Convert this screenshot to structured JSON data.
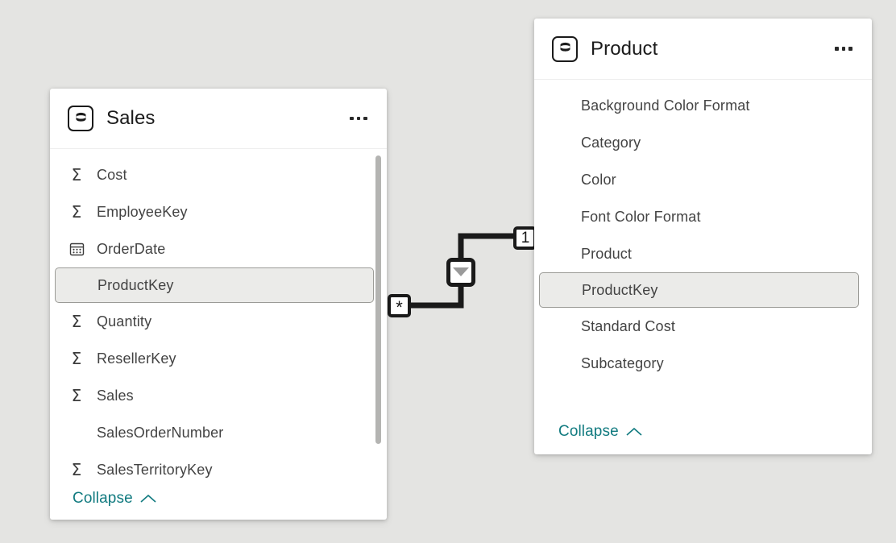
{
  "canvas": {
    "background_color": "#e4e4e2"
  },
  "tables": [
    {
      "id": "sales",
      "title": "Sales",
      "icon": "table-database-icon",
      "menu_label": "More options",
      "collapse_label": "Collapse",
      "fields": [
        {
          "name": "Cost",
          "icon": "sigma-icon"
        },
        {
          "name": "EmployeeKey",
          "icon": "sigma-icon"
        },
        {
          "name": "OrderDate",
          "icon": "calendar-icon"
        },
        {
          "name": "ProductKey",
          "icon": "none",
          "selected": true
        },
        {
          "name": "Quantity",
          "icon": "sigma-icon"
        },
        {
          "name": "ResellerKey",
          "icon": "sigma-icon"
        },
        {
          "name": "Sales",
          "icon": "sigma-icon"
        },
        {
          "name": "SalesOrderNumber",
          "icon": "none"
        },
        {
          "name": "SalesTerritoryKey",
          "icon": "sigma-icon"
        }
      ],
      "has_scrollbar": true
    },
    {
      "id": "product",
      "title": "Product",
      "icon": "table-database-icon",
      "menu_label": "More options",
      "collapse_label": "Collapse",
      "fields": [
        {
          "name": "Background Color Format",
          "icon": "none"
        },
        {
          "name": "Category",
          "icon": "none"
        },
        {
          "name": "Color",
          "icon": "none"
        },
        {
          "name": "Font Color Format",
          "icon": "none"
        },
        {
          "name": "Product",
          "icon": "none"
        },
        {
          "name": "ProductKey",
          "icon": "none",
          "selected": true
        },
        {
          "name": "Standard Cost",
          "icon": "none"
        },
        {
          "name": "Subcategory",
          "icon": "none"
        }
      ],
      "has_scrollbar": false
    }
  ],
  "relationship": {
    "from_table": "sales",
    "from_field": "ProductKey",
    "to_table": "product",
    "to_field": "ProductKey",
    "many_cardinality": "*",
    "one_cardinality": "1",
    "cross_filter_direction": "single",
    "cross_filter_icon": "filter-arrow-down-icon",
    "line_color": "#1a1a1a"
  },
  "theme": {
    "accent_link_color": "#127b80",
    "card_background": "#ffffff",
    "selected_row_background": "#ebebe9",
    "selected_row_border": "#9b9b97",
    "text_color": "#434343",
    "title_color": "#1b1b1b",
    "scrollbar_color": "#b4b4b2"
  }
}
